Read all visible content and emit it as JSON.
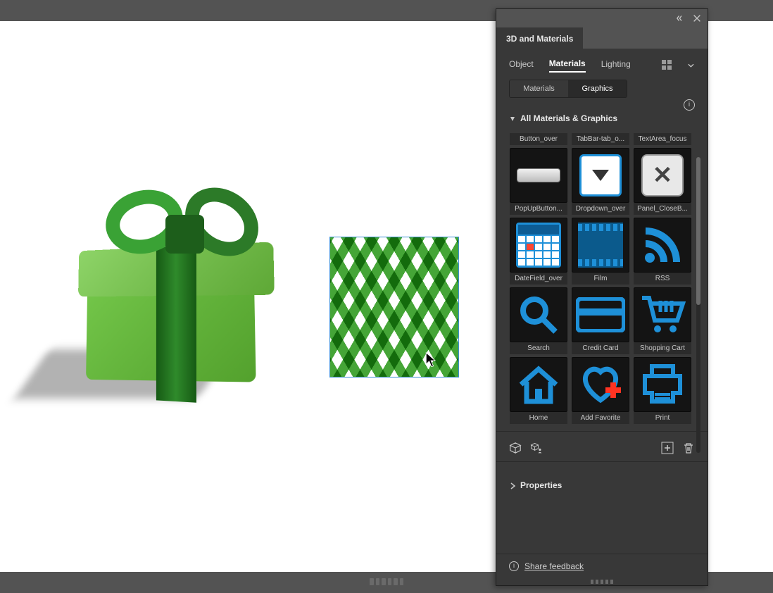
{
  "panel": {
    "title": "3D and Materials",
    "subtabs": [
      "Object",
      "Materials",
      "Lighting"
    ],
    "subtab_active": "Materials",
    "segment": {
      "materials": "Materials",
      "graphics": "Graphics",
      "active": "graphics"
    },
    "section_title": "All Materials & Graphics",
    "properties_title": "Properties",
    "footer": "Share feedback",
    "grid": [
      {
        "label": "Button_over",
        "icon": "label-only"
      },
      {
        "label": "TabBar-tab_o...",
        "icon": "label-only"
      },
      {
        "label": "TextArea_focus",
        "icon": "label-only"
      },
      {
        "label": "PopUpButton...",
        "icon": "btn"
      },
      {
        "label": "Dropdown_over",
        "icon": "dropdown"
      },
      {
        "label": "Panel_CloseB...",
        "icon": "close"
      },
      {
        "label": "DateField_over",
        "icon": "calendar"
      },
      {
        "label": "Film",
        "icon": "film"
      },
      {
        "label": "RSS",
        "icon": "rss"
      },
      {
        "label": "Search",
        "icon": "search"
      },
      {
        "label": "Credit Card",
        "icon": "creditcard"
      },
      {
        "label": "Shopping Cart",
        "icon": "cart"
      },
      {
        "label": "Home",
        "icon": "home"
      },
      {
        "label": "Add Favorite",
        "icon": "favorite"
      },
      {
        "label": "Print",
        "icon": "print"
      }
    ]
  }
}
